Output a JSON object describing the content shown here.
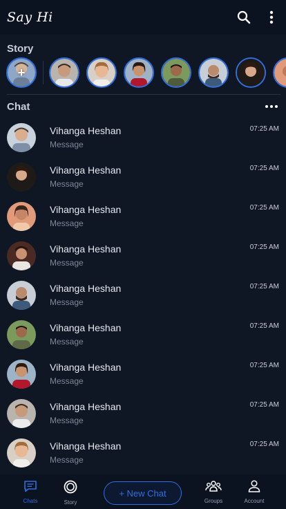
{
  "header": {
    "title": "Say Hi",
    "search_icon": "search-icon",
    "menu_icon": "more-vertical-icon"
  },
  "story": {
    "title": "Story",
    "add_symbol": "+",
    "avatars": [
      "a",
      "b",
      "c",
      "d",
      "e",
      "f",
      "g",
      "h"
    ]
  },
  "chat": {
    "title": "Chat",
    "items": [
      {
        "name": "Vihanga Heshan",
        "message": "Message",
        "time": "07:25 AM"
      },
      {
        "name": "Vihanga Heshan",
        "message": "Message",
        "time": "07:25 AM"
      },
      {
        "name": "Vihanga Heshan",
        "message": "Message",
        "time": "07:25 AM"
      },
      {
        "name": "Vihanga Heshan",
        "message": "Message",
        "time": "07:25 AM"
      },
      {
        "name": "Vihanga Heshan",
        "message": "Message",
        "time": "07:25 AM"
      },
      {
        "name": "Vihanga Heshan",
        "message": "Message",
        "time": "07:25 AM"
      },
      {
        "name": "Vihanga Heshan",
        "message": "Message",
        "time": "07:25 AM"
      },
      {
        "name": "Vihanga Heshan",
        "message": "Message",
        "time": "07:25 AM"
      },
      {
        "name": "Vihanga Heshan",
        "message": "Message",
        "time": "07:25 AM"
      }
    ]
  },
  "nav": {
    "chats": "Chats",
    "story": "Story",
    "new_chat": "+ New Chat",
    "groups": "Groups",
    "account": "Account"
  },
  "colors": {
    "background": "#0f1725",
    "bar": "#0b1220",
    "accent": "#2f6fe0"
  }
}
